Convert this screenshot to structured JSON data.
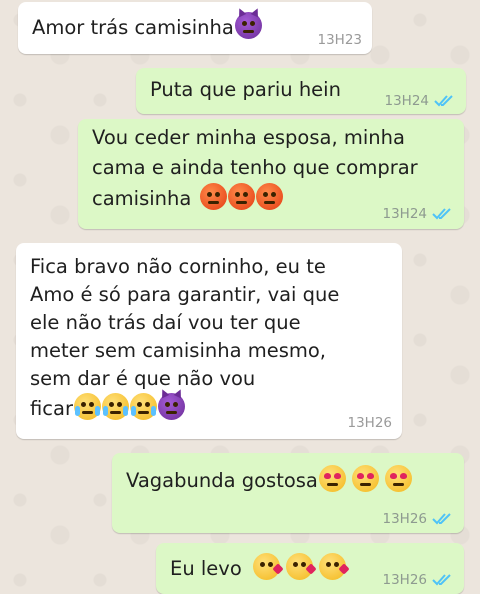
{
  "messages": [
    {
      "direction": "incoming",
      "text": "Amor trás camisinha",
      "emojis": [
        "smiling-imp"
      ],
      "time": "13H23"
    },
    {
      "direction": "outgoing",
      "text": "Puta que pariu hein",
      "emojis": [],
      "time": "13H24",
      "status": "read"
    },
    {
      "direction": "outgoing",
      "text": "Vou ceder minha esposa,  minha\ncama e ainda tenho que comprar\ncamisinha",
      "emojis": [
        "angry",
        "angry",
        "angry"
      ],
      "time": "13H24",
      "status": "read"
    },
    {
      "direction": "incoming",
      "text": "Fica bravo não corninho, eu te\nAmo é só para garantir, vai que\nele não trás daí vou ter que\nmeter sem camisinha mesmo,\nsem dar é que não vou\nficar",
      "emojis": [
        "joy",
        "joy",
        "joy",
        "smiling-imp"
      ],
      "time": "13H26"
    },
    {
      "direction": "outgoing",
      "text": "Vagabunda gostosa",
      "emojis": [
        "heart-eyes",
        "heart-eyes",
        "heart-eyes"
      ],
      "time": "13H26",
      "status": "read"
    },
    {
      "direction": "outgoing",
      "text": "Eu levo",
      "emojis": [
        "kissing-heart",
        "kissing-heart",
        "kissing-heart"
      ],
      "time": "13H26",
      "status": "read"
    }
  ],
  "colors": {
    "incoming_bubble": "#ffffff",
    "outgoing_bubble": "#dcf8c6",
    "read_tick": "#4fc3f7",
    "background": "#ece5dd"
  }
}
